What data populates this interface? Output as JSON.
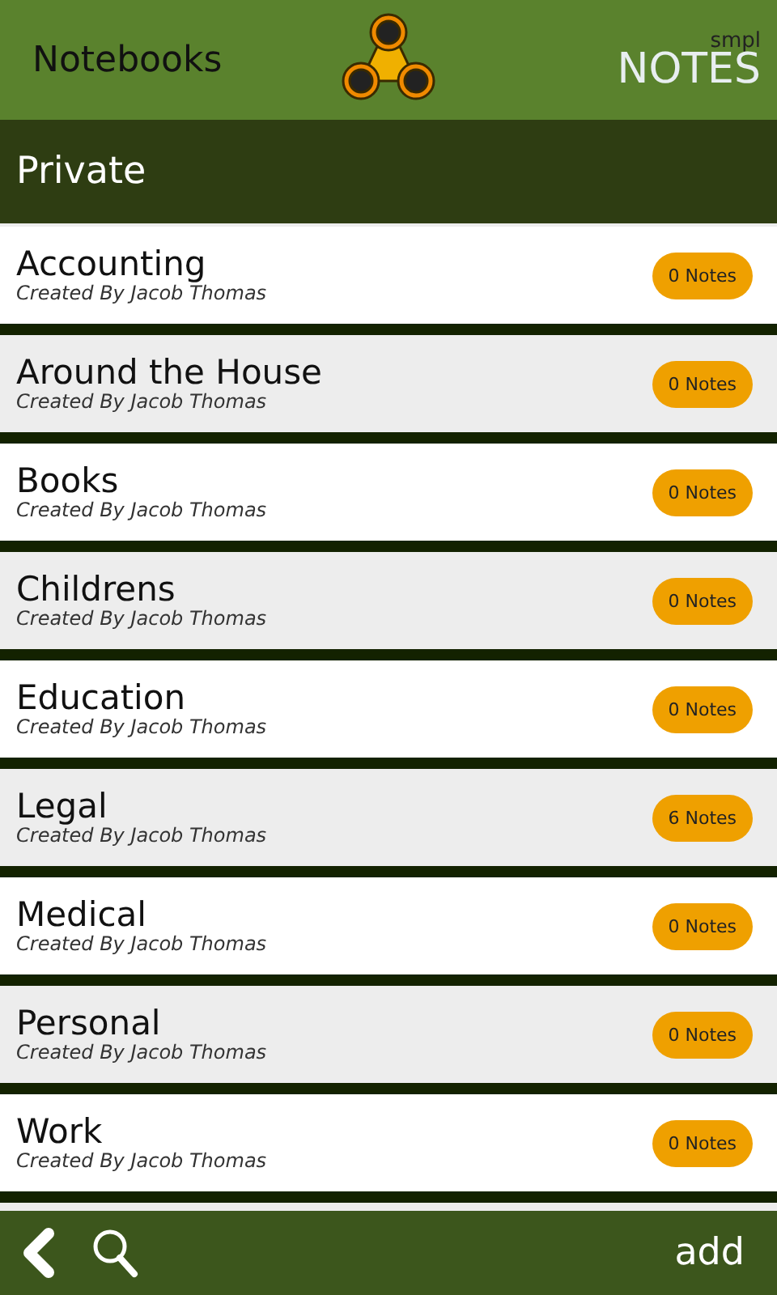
{
  "header": {
    "title": "Notebooks",
    "brand_small": "smpl",
    "brand_large": "NOTES"
  },
  "section": {
    "title": "Private"
  },
  "notebooks": [
    {
      "name": "Accounting",
      "author": "Created By Jacob Thomas",
      "count": "0 Notes"
    },
    {
      "name": "Around the House",
      "author": "Created By Jacob Thomas",
      "count": "0 Notes"
    },
    {
      "name": "Books",
      "author": "Created By Jacob Thomas",
      "count": "0 Notes"
    },
    {
      "name": "Childrens",
      "author": "Created By Jacob Thomas",
      "count": "0 Notes"
    },
    {
      "name": "Education",
      "author": "Created By Jacob Thomas",
      "count": "0 Notes"
    },
    {
      "name": "Legal",
      "author": "Created By Jacob Thomas",
      "count": "6 Notes"
    },
    {
      "name": "Medical",
      "author": "Created By Jacob Thomas",
      "count": "0 Notes"
    },
    {
      "name": "Personal",
      "author": "Created By Jacob Thomas",
      "count": "0 Notes"
    },
    {
      "name": "Work",
      "author": "Created By Jacob Thomas",
      "count": "0 Notes"
    }
  ],
  "footer": {
    "add": "add"
  }
}
